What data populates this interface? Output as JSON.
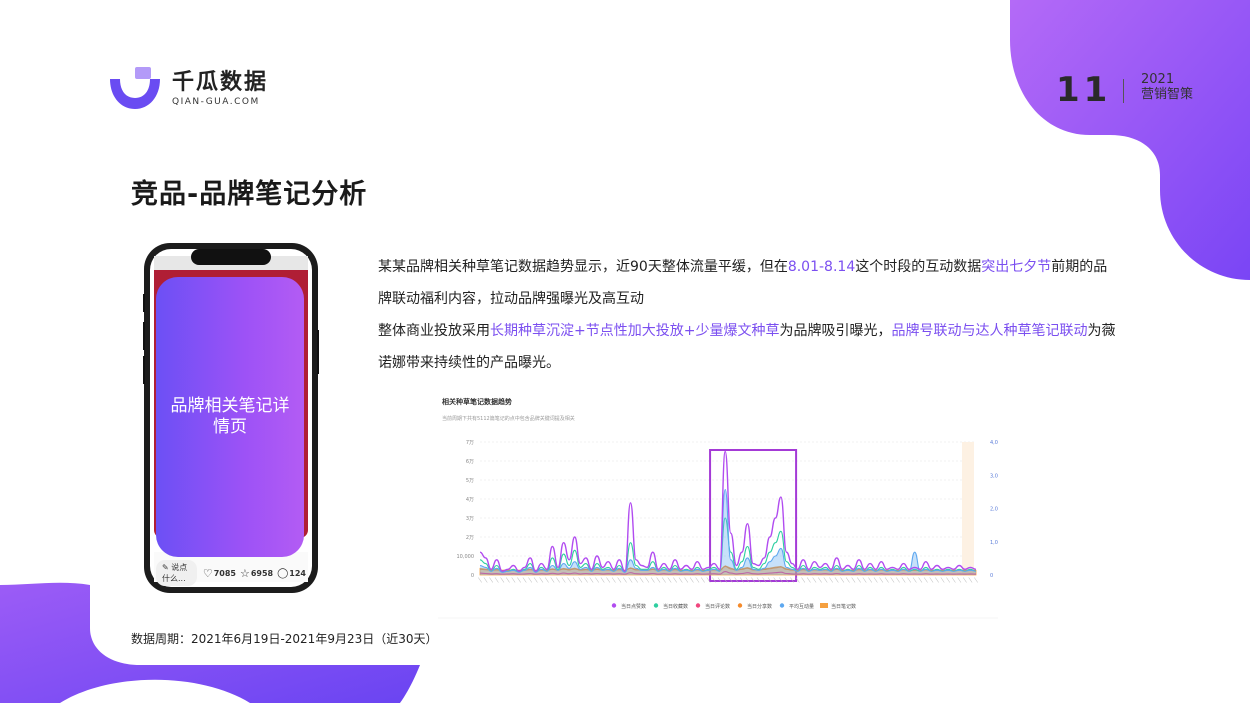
{
  "logo": {
    "cn": "千瓜数据",
    "en": "QIAN-GUA.COM"
  },
  "header": {
    "page_number": "11",
    "year": "2021",
    "series": "营销智策"
  },
  "title": "竞品-品牌笔记分析",
  "phone": {
    "overlay_label": "品牌相关笔记详情页",
    "comment_placeholder": "说点什么...",
    "like_count": "7085",
    "star_count": "6958",
    "comment_count": "124"
  },
  "description": {
    "line1_a": "某某品牌相关种草笔记数据趋势显示，近90天整体流量平缓，但在",
    "line1_b": "8.01-8.14",
    "line1_c": "这个时段的互动数据",
    "line1_d": "突出七夕节",
    "line1_e": "前期的品牌联动福利内容，拉动品牌强曝光及高互动",
    "line2_a": "整体商业投放采用",
    "line2_b": "长期种草沉淀+节点性加大投放+少量爆文种草",
    "line2_c": "为品牌吸引曝光，",
    "line2_d": "品牌号联动与达人种草笔记联动",
    "line2_e": "为薇诺娜带来持续性的产品曝光。"
  },
  "colors": {
    "accent": "#7b4ff0",
    "purple": "#8a4dff",
    "violet_line": "#b14cf0",
    "teal": "#2ecfa0",
    "pink": "#f0467e",
    "orange": "#f58a2a",
    "blue": "#5ea8f0",
    "highlight_box": "#a43ad6"
  },
  "chart_data": {
    "type": "line",
    "title": "相关种草笔记数据趋势",
    "subtitle": "当前周期下共有5112篇笔记的点中包含品牌关键词提及相关",
    "y_left_ticks": [
      "7万",
      "6万",
      "5万",
      "4万",
      "3万",
      "2万",
      "10,000",
      "0"
    ],
    "y_right_ticks": [
      "4,000",
      "3,000",
      "2,000",
      "1,000",
      "0"
    ],
    "ylim_left": [
      0,
      70000
    ],
    "ylim_right": [
      0,
      4000
    ],
    "highlight_range": [
      "08-01",
      "08-14"
    ],
    "series": [
      {
        "name": "当日点赞数",
        "color": "#b14cf0",
        "values": [
          12000,
          9000,
          3000,
          8000,
          2000,
          3000,
          5000,
          2000,
          4000,
          9000,
          2000,
          6000,
          3000,
          15000,
          4000,
          17000,
          8000,
          20000,
          6000,
          9000,
          3000,
          10000,
          4000,
          7000,
          3000,
          8000,
          2000,
          38000,
          8000,
          5000,
          4000,
          12000,
          3000,
          6000,
          3000,
          8000,
          3000,
          5000,
          3000,
          7000,
          3000,
          4000,
          6000,
          3000,
          65000,
          22000,
          5000,
          12000,
          27000,
          6000,
          5000,
          9000,
          20000,
          30000,
          41000,
          12000,
          6000,
          3000,
          8000,
          3000,
          7000,
          4000,
          6000,
          3000,
          9000,
          3000,
          5000,
          3000,
          8000,
          3000,
          6000,
          3000,
          7000,
          3000,
          4000,
          3000,
          6000,
          3000,
          4000,
          3000,
          7000,
          3000,
          5000,
          3000,
          4000,
          3000,
          5000,
          3000,
          4000,
          3000
        ]
      },
      {
        "name": "当日收藏数",
        "color": "#2ecfa0",
        "values": [
          8000,
          6000,
          2000,
          5000,
          1500,
          2000,
          3000,
          1500,
          3000,
          6000,
          1500,
          4000,
          2000,
          9000,
          3000,
          11000,
          5000,
          13000,
          4000,
          6000,
          2000,
          6000,
          3000,
          4000,
          2000,
          5000,
          1500,
          17000,
          5000,
          3000,
          3000,
          7000,
          2000,
          4000,
          2000,
          5000,
          2000,
          3000,
          2000,
          4000,
          2000,
          3000,
          4000,
          2000,
          30000,
          12000,
          3000,
          7000,
          15000,
          4000,
          3000,
          6000,
          12000,
          17000,
          23000,
          7000,
          4000,
          2000,
          5000,
          2000,
          4000,
          3000,
          4000,
          2000,
          5000,
          2000,
          3000,
          2000,
          5000,
          2000,
          4000,
          2000,
          4000,
          2000,
          3000,
          2000,
          4000,
          2000,
          3000,
          2000,
          4000,
          2000,
          3000,
          2000,
          3000,
          2000,
          3000,
          2000,
          3000,
          2000
        ]
      },
      {
        "name": "当日评论数",
        "color": "#f0467e",
        "values": [
          1000,
          800,
          600,
          700,
          500,
          600,
          700,
          500,
          600,
          800,
          500,
          700,
          600,
          900,
          600,
          1000,
          700,
          1000,
          600,
          800,
          600,
          800,
          600,
          700,
          600,
          700,
          500,
          1200,
          700,
          600,
          600,
          800,
          500,
          700,
          500,
          700,
          500,
          600,
          500,
          700,
          500,
          600,
          700,
          500,
          1800,
          1000,
          600,
          800,
          1200,
          700,
          600,
          800,
          1000,
          1200,
          1500,
          800,
          600,
          500,
          700,
          500,
          700,
          600,
          700,
          500,
          800,
          500,
          600,
          500,
          700,
          500,
          600,
          500,
          700,
          500,
          600,
          500,
          700,
          500,
          600,
          500,
          700,
          500,
          600,
          500,
          600,
          500,
          600,
          500,
          600,
          500
        ]
      },
      {
        "name": "当日分享数",
        "color": "#f58a2a",
        "values": [
          3000,
          2800,
          2500,
          2700,
          2400,
          2500,
          2600,
          2400,
          2500,
          2800,
          2400,
          2600,
          2500,
          3000,
          2600,
          3100,
          2700,
          3200,
          2600,
          2800,
          2500,
          2900,
          2600,
          2700,
          2500,
          2800,
          2400,
          3500,
          2700,
          2600,
          2500,
          2900,
          2400,
          2700,
          2400,
          2800,
          2400,
          2600,
          2400,
          2700,
          2400,
          2500,
          2700,
          2400,
          4500,
          3200,
          2600,
          3000,
          3600,
          2700,
          2600,
          2900,
          3300,
          3800,
          4200,
          3000,
          2600,
          2400,
          2800,
          2400,
          2700,
          2500,
          2700,
          2400,
          2900,
          2400,
          2600,
          2400,
          2800,
          2400,
          2700,
          2400,
          2700,
          2400,
          2500,
          2400,
          2700,
          2400,
          2500,
          2400,
          2700,
          2400,
          2600,
          2400,
          2500,
          2400,
          2600,
          2400,
          2500,
          2400
        ]
      },
      {
        "name": "平均互动量",
        "color": "#5ea8f0",
        "values": [
          5000,
          4000,
          2000,
          3500,
          1500,
          2000,
          2500,
          1500,
          2500,
          4000,
          1500,
          3000,
          2000,
          5000,
          2500,
          6000,
          3500,
          7000,
          3000,
          4000,
          2000,
          4000,
          2500,
          3000,
          2000,
          3500,
          1500,
          8000,
          3500,
          2500,
          2500,
          4000,
          2000,
          3000,
          2000,
          3500,
          2000,
          2500,
          2000,
          3000,
          2000,
          2500,
          3000,
          2000,
          45000,
          8000,
          2500,
          4000,
          9000,
          3000,
          2500,
          3500,
          7000,
          10000,
          14000,
          4000,
          3000,
          2000,
          3500,
          2000,
          3000,
          2500,
          3000,
          2000,
          3500,
          2000,
          2500,
          2000,
          3500,
          2000,
          3000,
          2000,
          3000,
          2000,
          2500,
          2000,
          3000,
          2000,
          12000,
          2000,
          3000,
          2000,
          2500,
          2000,
          2500,
          2000,
          2500,
          2000,
          2500,
          2000
        ]
      },
      {
        "name": "当日笔记数",
        "color": "#f5a040",
        "values": [
          200,
          180,
          150,
          170,
          140,
          150,
          160,
          140,
          150,
          180,
          140,
          160,
          150,
          190,
          160,
          200,
          170,
          210,
          160,
          180,
          150,
          190,
          160,
          170,
          150,
          180,
          140,
          220,
          170,
          160,
          150,
          190,
          140,
          170,
          140,
          180,
          140,
          160,
          140,
          170,
          140,
          150,
          170,
          140,
          280,
          210,
          160,
          190,
          230,
          170,
          160,
          190,
          210,
          240,
          260,
          190,
          160,
          140,
          180,
          140,
          170,
          150,
          170,
          140,
          190,
          140,
          160,
          140,
          180,
          140,
          170,
          140,
          170,
          140,
          150,
          140,
          170,
          140,
          150,
          140,
          170,
          140,
          160,
          140,
          150,
          140,
          160,
          140,
          150,
          140
        ]
      }
    ]
  },
  "footer": "数据周期：2021年6月19日-2021年9月23日（近30天）"
}
